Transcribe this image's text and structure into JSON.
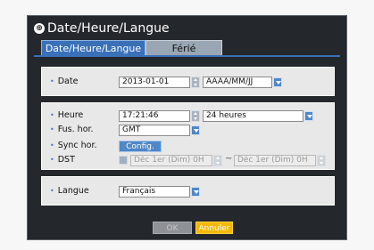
{
  "dialog": {
    "title": "Date/Heure/Langue",
    "tabs": [
      {
        "label": "Date/Heure/Langue",
        "active": true
      },
      {
        "label": "Férié",
        "active": false
      }
    ]
  },
  "date_section": {
    "date_label": "Date",
    "date_value": "2013-01-01",
    "format_value": "AAAA/MM/JJ"
  },
  "time_section": {
    "heure_label": "Heure",
    "heure_value": "17:21:46",
    "heure_format_value": "24 heures",
    "fus_label": "Fus. hor.",
    "fus_value": "GMT",
    "sync_label": "Sync hor.",
    "sync_button": "Config.",
    "dst_label": "DST",
    "dst_from": "Déc 1er (Dim) 0H",
    "dst_tilde": "~",
    "dst_to": "Déc 1er (Dim) 0H"
  },
  "language_section": {
    "langue_label": "Langue",
    "langue_value": "Français"
  },
  "footer": {
    "ok_label": "OK",
    "cancel_label": "Annuler"
  },
  "colors": {
    "accent": "#3970b8",
    "cancel": "#f5b800",
    "dialog_bg": "#24272b"
  }
}
